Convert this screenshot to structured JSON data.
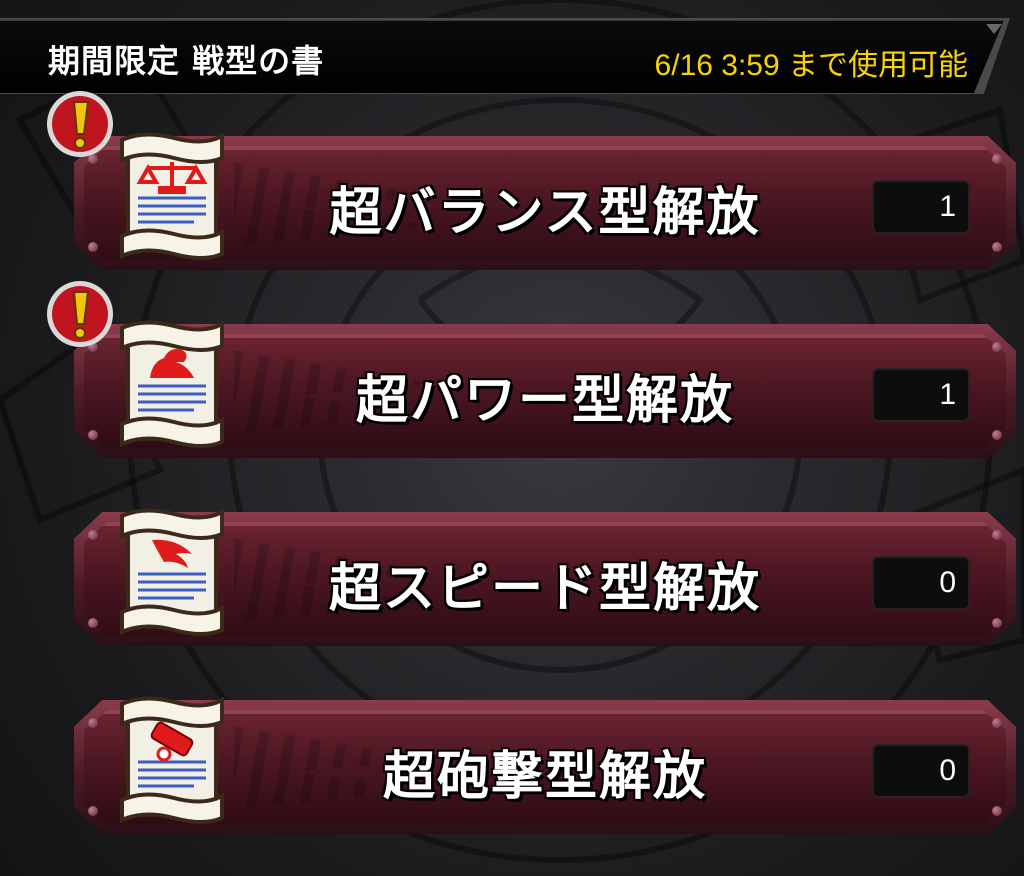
{
  "header": {
    "title": "期間限定 戦型の書",
    "deadline": "6/16 3:59 まで使用可能"
  },
  "items": [
    {
      "label": "超バランス型解放",
      "count": "1",
      "icon": "scales-icon",
      "alert": true
    },
    {
      "label": "超パワー型解放",
      "count": "1",
      "icon": "flexed-arm-icon",
      "alert": true
    },
    {
      "label": "超スピード型解放",
      "count": "0",
      "icon": "wing-icon",
      "alert": false
    },
    {
      "label": "超砲撃型解放",
      "count": "0",
      "icon": "cannon-icon",
      "alert": false
    }
  ],
  "colors": {
    "deadline": "#f7d400",
    "row": "#5a1c2a",
    "alert": "#c0141f",
    "alert_mark": "#f1c40f",
    "icon_red": "#e01b1b"
  }
}
